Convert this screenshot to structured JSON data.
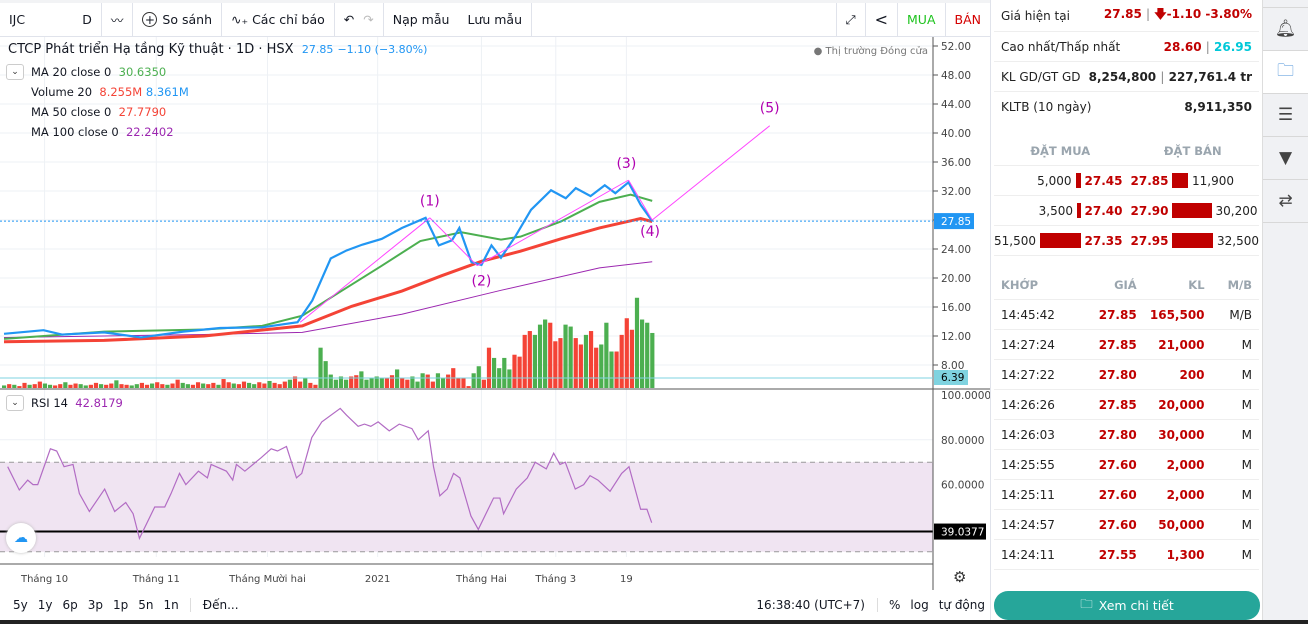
{
  "toolbar": {
    "symbol": "IJC",
    "interval": "D",
    "compare": "So sánh",
    "indicators": "Các chỉ báo",
    "load_template": "Nạp mẫu",
    "save_template": "Lưu mẫu",
    "buy": "MUA",
    "sell": "BÁN"
  },
  "legend": {
    "title": "CTCP Phát triển Hạ tầng Kỹ thuật · 1D · HSX",
    "price": "27.85",
    "change": "−1.10 (−3.80%)",
    "market_status": "Thị trường Đóng cửa",
    "ma20_label": "MA 20 close 0",
    "ma20_value": "30.6350",
    "volume_label": "Volume 20",
    "volume_value1": "8.255M",
    "volume_value2": "8.361M",
    "ma50_label": "MA 50 close 0",
    "ma50_value": "27.7790",
    "ma100_label": "MA 100 close 0",
    "ma100_value": "22.2402",
    "rsi_label": "RSI 14",
    "rsi_value": "42.8179"
  },
  "colors": {
    "price": "#2196f3",
    "ma20": "#4caf50",
    "ma50": "#f44336",
    "ma100": "#9c27b0",
    "rsi": "#b26cc4",
    "trend": "#ff44ff",
    "wave_label": "#b000b0",
    "up": "#4caf50",
    "down": "#f44336"
  },
  "chart_data": {
    "type": "line",
    "x_range": [
      0,
      123
    ],
    "price_axis": {
      "ticks": [
        "52.00",
        "48.00",
        "44.00",
        "40.00",
        "36.00",
        "32.00",
        "28.00",
        "24.00",
        "20.00",
        "16.00",
        "12.00",
        "8.00"
      ],
      "min": 8,
      "max": 52,
      "last_label": "27.85",
      "volume_label": "6.39"
    },
    "rsi_axis": {
      "ticks": [
        "100.0000",
        "80.0000",
        "60.0000"
      ],
      "last_label": "39.0377",
      "band": [
        30,
        70
      ],
      "level_line": 39.04
    },
    "x_labels": [
      {
        "i": 7.7,
        "t": "Tháng 10"
      },
      {
        "i": 28.9,
        "t": "Tháng 11"
      },
      {
        "i": 50,
        "t": "Tháng Mười hai"
      },
      {
        "i": 70.9,
        "t": "2021"
      },
      {
        "i": 90.6,
        "t": "Tháng Hai"
      },
      {
        "i": 104.7,
        "t": "Tháng 3"
      },
      {
        "i": 118.1,
        "t": "19"
      }
    ],
    "close": [
      [
        0,
        12.3
      ],
      [
        7.5,
        12.8
      ],
      [
        11,
        12.2
      ],
      [
        19,
        12.5
      ],
      [
        26,
        11.8
      ],
      [
        34,
        12.6
      ],
      [
        41,
        13.1
      ],
      [
        49,
        13.2
      ],
      [
        55.7,
        13.9
      ],
      [
        58.5,
        16.9
      ],
      [
        62,
        22.7
      ],
      [
        65,
        23.8
      ],
      [
        68,
        24.6
      ],
      [
        71.7,
        25.4
      ],
      [
        75.5,
        26.9
      ],
      [
        80,
        28.3
      ],
      [
        82.5,
        24.5
      ],
      [
        85,
        25.2
      ],
      [
        86.4,
        26.9
      ],
      [
        88.7,
        22.2
      ],
      [
        90.6,
        21.8
      ],
      [
        92.5,
        24.5
      ],
      [
        94.3,
        22.8
      ],
      [
        97,
        25.7
      ],
      [
        100,
        29.4
      ],
      [
        103.8,
        32.1
      ],
      [
        106.6,
        31.0
      ],
      [
        108.5,
        32.4
      ],
      [
        111.3,
        31.3
      ],
      [
        114,
        32.8
      ],
      [
        116,
        31.7
      ],
      [
        118.5,
        33.2
      ],
      [
        120.8,
        30.1
      ],
      [
        123,
        27.85
      ]
    ],
    "ma20": [
      [
        0,
        11.6
      ],
      [
        19,
        12.6
      ],
      [
        38,
        12.9
      ],
      [
        49,
        13.4
      ],
      [
        56.6,
        14.8
      ],
      [
        64,
        18.2
      ],
      [
        71.7,
        21.7
      ],
      [
        79,
        25.1
      ],
      [
        86.8,
        26.3
      ],
      [
        94.3,
        25.3
      ],
      [
        98,
        25.7
      ],
      [
        105.7,
        27.8
      ],
      [
        113,
        30.5
      ],
      [
        118.9,
        31.5
      ],
      [
        123,
        30.64
      ]
    ],
    "ma50": [
      [
        0,
        11.2
      ],
      [
        19,
        11.4
      ],
      [
        38,
        12.0
      ],
      [
        56.6,
        13.4
      ],
      [
        66,
        16.1
      ],
      [
        75.5,
        18.2
      ],
      [
        83,
        20.3
      ],
      [
        90.6,
        22.3
      ],
      [
        98,
        23.7
      ],
      [
        105.7,
        25.4
      ],
      [
        113,
        26.9
      ],
      [
        120.8,
        28.2
      ],
      [
        123,
        27.78
      ]
    ],
    "ma100": [
      [
        0,
        11.8
      ],
      [
        19,
        12.0
      ],
      [
        38,
        12.2
      ],
      [
        56.6,
        12.5
      ],
      [
        75.5,
        15.0
      ],
      [
        94.3,
        18.3
      ],
      [
        113,
        21.4
      ],
      [
        123,
        22.24
      ]
    ],
    "volume_m": [
      0.4,
      0.6,
      0.5,
      0.3,
      0.8,
      0.5,
      0.6,
      1.0,
      0.7,
      0.5,
      0.4,
      0.6,
      0.9,
      0.5,
      0.7,
      0.6,
      0.4,
      0.5,
      0.8,
      0.6,
      0.5,
      0.7,
      1.2,
      0.6,
      0.5,
      0.4,
      0.6,
      0.8,
      0.5,
      0.7,
      0.9,
      0.6,
      0.5,
      0.7,
      1.3,
      0.8,
      0.6,
      0.5,
      0.9,
      0.7,
      0.6,
      0.8,
      0.5,
      1.4,
      0.9,
      0.7,
      0.6,
      1.0,
      0.8,
      0.6,
      0.9,
      0.7,
      1.1,
      0.8,
      0.6,
      1.0,
      1.3,
      1.8,
      1.0,
      1.6,
      0.8,
      0.5,
      6.3,
      4.2,
      2.1,
      1.3,
      1.8,
      1.3,
      1.8,
      2.0,
      2.6,
      1.3,
      1.5,
      1.8,
      1.5,
      1.6,
      2.0,
      2.9,
      1.6,
      1.3,
      1.8,
      1.0,
      2.3,
      2.1,
      1.0,
      2.3,
      1.6,
      2.1,
      3.1,
      1.6,
      1.6,
      0.3,
      2.3,
      3.4,
      1.3,
      6.3,
      4.7,
      3.1,
      4.7,
      2.9,
      5.2,
      4.9,
      8.3,
      8.9,
      8.3,
      9.9,
      10.7,
      10.2,
      7.3,
      7.8,
      9.9,
      9.6,
      7.8,
      6.8,
      8.3,
      8.9,
      6.3,
      6.8,
      10.2,
      5.7,
      5.7,
      8.3,
      10.9,
      9.1,
      14.1,
      10.7,
      10.2,
      8.6
    ],
    "volume_dir": "ududdudduuddudduudduddudduudduddudduuddudduddudduudduddduddudduuuuuuddugguuddudduuudduuddddduudduuuudddduuuddduuddudduuudddd",
    "rsi": [
      [
        0.7,
        68
      ],
      [
        2.9,
        57.6
      ],
      [
        4.5,
        62
      ],
      [
        5.5,
        60
      ],
      [
        6.4,
        60
      ],
      [
        8.8,
        76
      ],
      [
        10,
        75
      ],
      [
        11.4,
        68
      ],
      [
        13.1,
        69
      ],
      [
        14.3,
        56
      ],
      [
        16.2,
        48
      ],
      [
        19.1,
        58
      ],
      [
        21,
        48
      ],
      [
        23.1,
        52
      ],
      [
        24.5,
        47
      ],
      [
        25.7,
        36
      ],
      [
        28.6,
        50
      ],
      [
        30.5,
        50
      ],
      [
        31.7,
        56
      ],
      [
        33.3,
        65
      ],
      [
        34.5,
        60
      ],
      [
        36.9,
        66
      ],
      [
        38.6,
        63
      ],
      [
        39.3,
        69
      ],
      [
        42.2,
        66
      ],
      [
        43.4,
        62
      ],
      [
        44.1,
        69
      ],
      [
        45.7,
        66
      ],
      [
        48.8,
        72
      ],
      [
        50.7,
        76
      ],
      [
        51.9,
        75
      ],
      [
        53.6,
        77
      ],
      [
        55.5,
        63
      ],
      [
        56.5,
        65
      ],
      [
        58.4,
        81
      ],
      [
        60.3,
        88
      ],
      [
        63.8,
        94
      ],
      [
        65,
        91
      ],
      [
        67.2,
        86
      ],
      [
        68.4,
        87
      ],
      [
        69.6,
        86
      ],
      [
        71,
        88
      ],
      [
        73.1,
        84
      ],
      [
        75,
        87
      ],
      [
        77.4,
        85
      ],
      [
        78.6,
        80
      ],
      [
        80.5,
        84
      ],
      [
        81.5,
        68
      ],
      [
        82.7,
        55
      ],
      [
        84.1,
        58
      ],
      [
        85.3,
        65
      ],
      [
        86.5,
        63
      ],
      [
        88.6,
        46
      ],
      [
        90,
        40
      ],
      [
        92.9,
        54
      ],
      [
        94.1,
        54
      ],
      [
        94.8,
        47
      ],
      [
        97.2,
        58
      ],
      [
        99.3,
        63
      ],
      [
        100.8,
        70
      ],
      [
        102.9,
        67
      ],
      [
        104.3,
        74
      ],
      [
        105.5,
        69
      ],
      [
        106.5,
        70
      ],
      [
        108.4,
        58
      ],
      [
        110,
        60
      ],
      [
        111.2,
        64
      ],
      [
        112.7,
        62
      ],
      [
        115,
        57
      ],
      [
        117.2,
        65
      ],
      [
        118.6,
        68
      ],
      [
        120.8,
        49
      ],
      [
        122,
        49
      ],
      [
        122.9,
        43
      ]
    ],
    "trendlines": [
      [
        [
          56.2,
          13.9
        ],
        [
          80.8,
          28.3
        ]
      ],
      [
        [
          80.8,
          28.3
        ],
        [
          89.8,
          21.7
        ]
      ],
      [
        [
          89.8,
          21.7
        ],
        [
          118.5,
          33.5
        ]
      ],
      [
        [
          118.5,
          33.5
        ],
        [
          123,
          28.0
        ]
      ],
      [
        [
          123,
          28.0
        ],
        [
          145.3,
          41.0
        ]
      ]
    ],
    "wave_labels": [
      {
        "t": "(1)",
        "i": 80.8,
        "v": 30.0
      },
      {
        "t": "(2)",
        "i": 90.6,
        "v": 19.0
      },
      {
        "t": "(3)",
        "i": 118.1,
        "v": 35.2
      },
      {
        "t": "(4)",
        "i": 122.6,
        "v": 25.8
      },
      {
        "t": "(5)",
        "i": 145.3,
        "v": 42.8
      }
    ]
  },
  "bottombar": {
    "ranges": [
      "5y",
      "1y",
      "6p",
      "3p",
      "1p",
      "5n",
      "1n"
    ],
    "goto": "Đến...",
    "time": "16:38:40 (UTC+7)",
    "percent": "%",
    "log": "log",
    "auto": "tự động"
  },
  "panel": {
    "current_label": "Giá hiện tại",
    "current_price": "27.85",
    "current_change": "-1.10 -3.80%",
    "hl_label": "Cao nhất/Thấp nhất",
    "high": "28.60",
    "low": "26.95",
    "vol_label": "KL GD/GT GD",
    "vol": "8,254,800",
    "value": "227,761.4 tr",
    "avg_label": "KLTB (10 ngày)",
    "avg": "8,911,350",
    "bid_header": "ĐẶT MUA",
    "ask_header": "ĐẶT BÁN",
    "orderbook": [
      {
        "bid_vol": "5,000",
        "bid": "27.45",
        "ask": "27.85",
        "ask_vol": "11,900",
        "bid_frac": 0.1,
        "ask_frac": 0.37
      },
      {
        "bid_vol": "3,500",
        "bid": "27.40",
        "ask": "27.90",
        "ask_vol": "30,200",
        "bid_frac": 0.07,
        "ask_frac": 0.93
      },
      {
        "bid_vol": "51,500",
        "bid": "27.35",
        "ask": "27.95",
        "ask_vol": "32,500",
        "bid_frac": 1,
        "ask_frac": 1
      }
    ],
    "trade_headers": [
      "KHỚP",
      "GIÁ",
      "KL",
      "M/B"
    ],
    "trades": [
      [
        "14:45:42",
        "27.85",
        "165,500",
        "M/B"
      ],
      [
        "14:27:24",
        "27.85",
        "21,000",
        "M"
      ],
      [
        "14:27:22",
        "27.80",
        "200",
        "M"
      ],
      [
        "14:26:26",
        "27.85",
        "20,000",
        "M"
      ],
      [
        "14:26:03",
        "27.80",
        "30,000",
        "M"
      ],
      [
        "14:25:55",
        "27.60",
        "2,000",
        "M"
      ],
      [
        "14:25:11",
        "27.60",
        "2,000",
        "M"
      ],
      [
        "14:24:57",
        "27.60",
        "50,000",
        "M"
      ],
      [
        "14:24:11",
        "27.55",
        "1,300",
        "M"
      ]
    ],
    "detail_button": "Xem chi tiết"
  }
}
